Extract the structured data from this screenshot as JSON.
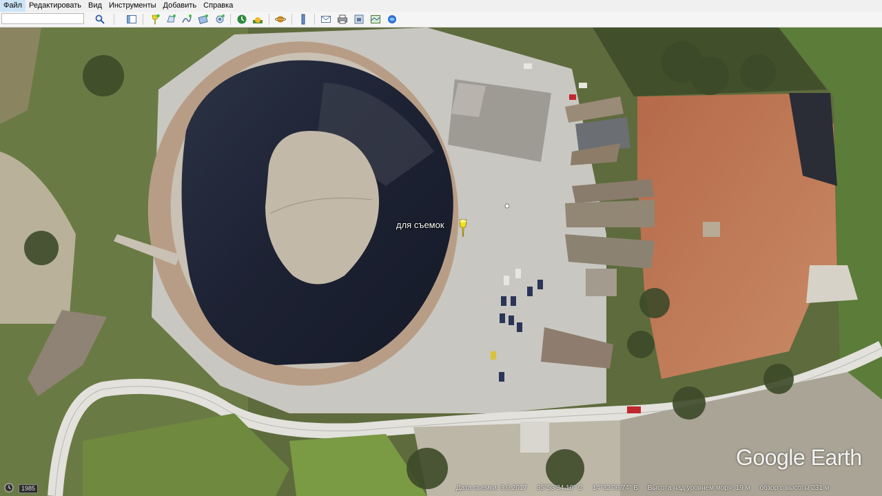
{
  "menu": {
    "items": [
      "Файл",
      "Редактировать",
      "Вид",
      "Инструменты",
      "Добавить",
      "Справка"
    ]
  },
  "toolbar": {
    "search_value": "",
    "buttons": [
      "search-icon",
      "sidebar-icon",
      "placemark-icon",
      "polygon-icon",
      "path-icon",
      "overlay-icon",
      "tour-icon",
      "historical-imagery-icon",
      "sun-icon",
      "planets-icon",
      "ruler-icon",
      "email-icon",
      "print-icon",
      "save-image-icon",
      "maps-icon",
      "gallery-icon"
    ]
  },
  "placemark": {
    "label": "для съемок",
    "color": "#f5e11a"
  },
  "logo": {
    "text": "Google Earth"
  },
  "history": {
    "year": "1985"
  },
  "status": {
    "date": "Дата съемки: 3.9.2017",
    "lat": "35°53'34.10\" С",
    "lon": "14°32'06.74\" В",
    "elevation": "Высота над уровнем моря:   19 м",
    "eye_alt": "обзор с высоты   231 м"
  }
}
